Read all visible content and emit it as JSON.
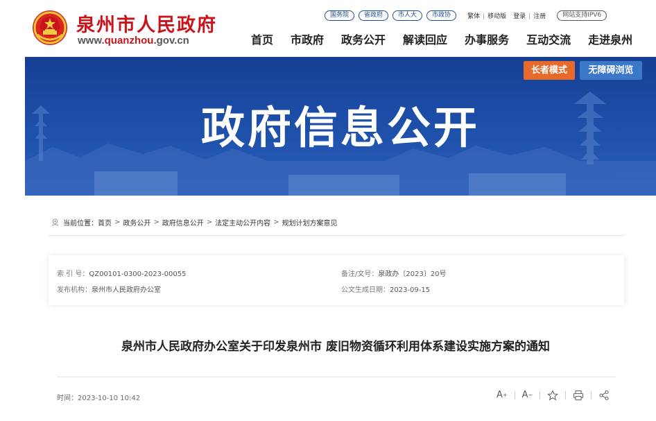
{
  "header": {
    "site_title": "泉州市人民政府",
    "url_prefix": "www.",
    "url_highlight": "quanzhou",
    "url_suffix": ".gov.cn",
    "top_links": [
      "国务院",
      "省政府",
      "市人大",
      "市政协"
    ],
    "util_links": [
      "繁体",
      "移动版",
      "登录",
      "注册"
    ],
    "ipv6_badge": "网站支持IPV6",
    "nav": [
      "首页",
      "市政府",
      "政务公开",
      "解读回应",
      "办事服务",
      "互动交流",
      "走进泉州"
    ]
  },
  "banner": {
    "title": "政府信息公开",
    "elder_mode_label": "长者模式",
    "accessibility_label": "无障碍浏览"
  },
  "breadcrumb": {
    "prefix": "当前位置：",
    "items": [
      "首页",
      "政务公开",
      "政府信息公开",
      "法定主动公开内容",
      "规划计划方案意见"
    ]
  },
  "meta": {
    "index_label": "索 引 号：",
    "index_value": "QZ00101-0300-2023-00055",
    "doc_no_label": "备注/文号：",
    "doc_no_value": "泉政办〔2023〕20号",
    "issuer_label": "发布机构：",
    "issuer_value": "泉州市人民政府办公室",
    "date_label": "公文生成日期：",
    "date_value": "2023-09-15"
  },
  "article": {
    "title": "泉州市人民政府办公室关于印发泉州市 废旧物资循环利用体系建设实施方案的通知",
    "time_label": "时间：",
    "time_value": "2023-10-10 10:42"
  },
  "tools": {
    "font_up": "A",
    "font_up_sup": "+",
    "font_down": "A",
    "font_down_sup": "−"
  },
  "icons": {
    "emblem": "national-emblem-icon",
    "location": "location-pin-icon",
    "star": "star-icon",
    "print": "print-icon",
    "share": "share-icon"
  },
  "colors": {
    "brand_red": "#c8141b",
    "nav_blue": "#1f4f99",
    "banner_blue": "#1c4ea8",
    "elder_orange": "#e56a2c",
    "access_blue": "#3b78c8"
  }
}
